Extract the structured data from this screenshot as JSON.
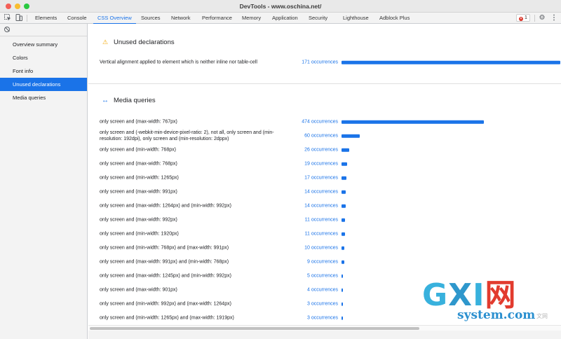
{
  "window": {
    "title": "DevTools - www.oschina.net/"
  },
  "tabs": [
    {
      "label": "Elements",
      "active": false
    },
    {
      "label": "Console",
      "active": false
    },
    {
      "label": "CSS Overview",
      "active": true
    },
    {
      "label": "Sources",
      "active": false
    },
    {
      "label": "Network",
      "active": false
    },
    {
      "label": "Performance",
      "active": false
    },
    {
      "label": "Memory",
      "active": false
    },
    {
      "label": "Application",
      "active": false
    },
    {
      "label": "Security",
      "active": false
    },
    {
      "label": "Lighthouse",
      "active": false
    },
    {
      "label": "Adblock Plus",
      "active": false
    }
  ],
  "toolbar": {
    "error_count": "1"
  },
  "sidebar": {
    "items": [
      {
        "label": "Overview summary",
        "active": false
      },
      {
        "label": "Colors",
        "active": false
      },
      {
        "label": "Font info",
        "active": false
      },
      {
        "label": "Unused declarations",
        "active": true
      },
      {
        "label": "Media queries",
        "active": false
      }
    ]
  },
  "unused": {
    "title": "Unused declarations",
    "rows": [
      {
        "label": "Vertical alignment applied to element which is neither inline nor table-cell",
        "occurrences": "171 occurrences",
        "count": 171
      }
    ]
  },
  "media": {
    "title": "Media queries",
    "rows": [
      {
        "label": "only screen and (max-width: 767px)",
        "occurrences": "474 occurrences",
        "count": 474
      },
      {
        "label": "only screen and (-webkit-min-device-pixel-ratio: 2), not all, only screen and (min-resolution: 192dpi), only screen and (min-resolution: 2dppx)",
        "occurrences": "60 occurrences",
        "count": 60
      },
      {
        "label": "only screen and (min-width: 768px)",
        "occurrences": "26 occurrences",
        "count": 26
      },
      {
        "label": "only screen and (max-width: 768px)",
        "occurrences": "19 occurrences",
        "count": 19
      },
      {
        "label": "only screen and (min-width: 1265px)",
        "occurrences": "17 occurrences",
        "count": 17
      },
      {
        "label": "only screen and (max-width: 991px)",
        "occurrences": "14 occurrences",
        "count": 14
      },
      {
        "label": "only screen and (max-width: 1264px) and (min-width: 992px)",
        "occurrences": "14 occurrences",
        "count": 14
      },
      {
        "label": "only screen and (max-width: 992px)",
        "occurrences": "11 occurrences",
        "count": 11
      },
      {
        "label": "only screen and (min-width: 1920px)",
        "occurrences": "11 occurrences",
        "count": 11
      },
      {
        "label": "only screen and (min-width: 768px) and (max-width: 991px)",
        "occurrences": "10 occurrences",
        "count": 10
      },
      {
        "label": "only screen and (max-width: 991px) and (min-width: 768px)",
        "occurrences": "9 occurrences",
        "count": 9
      },
      {
        "label": "only screen and (max-width: 1245px) and (min-width: 992px)",
        "occurrences": "5 occurrences",
        "count": 5
      },
      {
        "label": "only screen and (max-width: 901px)",
        "occurrences": "4 occurrences",
        "count": 4
      },
      {
        "label": "only screen and (min-width: 992px) and (max-width: 1264px)",
        "occurrences": "3 occurrences",
        "count": 3
      },
      {
        "label": "only screen and (min-width: 1265px) and (max-width: 1919px)",
        "occurrences": "3 occurrences",
        "count": 3
      }
    ]
  },
  "watermark": {
    "brand_g": "G",
    "brand_x": "X",
    "brand_i": "I",
    "brand_wang": "网",
    "domain": "system.com",
    "cn_suffix": "文网"
  },
  "colors": {
    "accent": "#1a73e8",
    "warning": "#f2a600",
    "error": "#d93025"
  }
}
